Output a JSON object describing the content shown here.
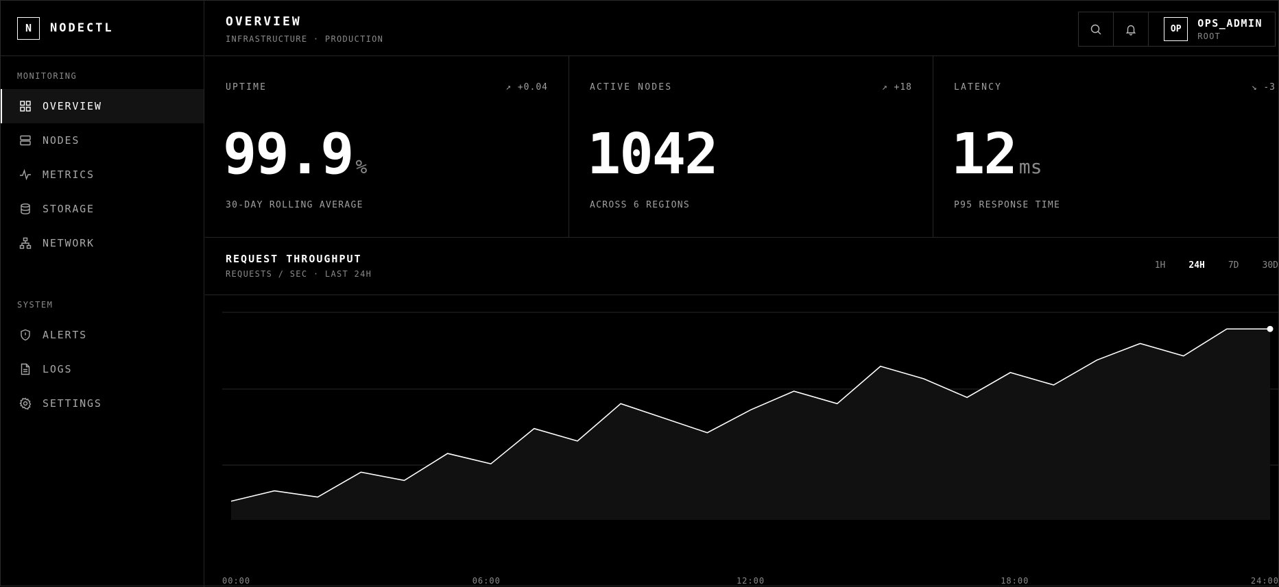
{
  "brand": {
    "logo": "N",
    "name": "NODECTL"
  },
  "sidebar": {
    "sections": [
      {
        "label": "MONITORING",
        "items": [
          {
            "label": "OVERVIEW",
            "icon": "grid-icon",
            "active": true
          },
          {
            "label": "NODES",
            "icon": "server-icon",
            "active": false
          },
          {
            "label": "METRICS",
            "icon": "activity-icon",
            "active": false
          },
          {
            "label": "STORAGE",
            "icon": "database-icon",
            "active": false
          },
          {
            "label": "NETWORK",
            "icon": "network-icon",
            "active": false
          }
        ]
      },
      {
        "label": "SYSTEM",
        "items": [
          {
            "label": "ALERTS",
            "icon": "shield-alert-icon",
            "active": false
          },
          {
            "label": "LOGS",
            "icon": "file-icon",
            "active": false
          },
          {
            "label": "SETTINGS",
            "icon": "gear-icon",
            "active": false
          }
        ]
      }
    ]
  },
  "header": {
    "title": "OVERVIEW",
    "subtitle": "INFRASTRUCTURE · PRODUCTION",
    "user": {
      "initials": "OP",
      "name": "OPS_ADMIN",
      "role": "ROOT"
    }
  },
  "stats": [
    {
      "label": "UPTIME",
      "delta_icon": "↗",
      "delta": "+0.04",
      "value": "99.9",
      "unit": "%",
      "caption": "30-DAY ROLLING AVERAGE"
    },
    {
      "label": "ACTIVE NODES",
      "delta_icon": "↗",
      "delta": "+18",
      "value": "1042",
      "unit": "",
      "caption": "ACROSS 6 REGIONS"
    },
    {
      "label": "LATENCY",
      "delta_icon": "↘",
      "delta": "-3",
      "value": "12",
      "unit": "ms",
      "caption": "P95 RESPONSE TIME"
    }
  ],
  "chart": {
    "title": "REQUEST THROUGHPUT",
    "subtitle": "REQUESTS / SEC · LAST 24H",
    "ranges": [
      {
        "label": "1H",
        "active": false
      },
      {
        "label": "24H",
        "active": true
      },
      {
        "label": "7D",
        "active": false
      },
      {
        "label": "30D",
        "active": false
      }
    ]
  },
  "chart_data": {
    "type": "area",
    "x_tick_labels": [
      "00:00",
      "06:00",
      "12:00",
      "18:00",
      "24:00"
    ],
    "x_range": [
      0,
      24
    ],
    "ylim": [
      0,
      100
    ],
    "grid": true,
    "series": [
      {
        "x": [
          0,
          1,
          2,
          3,
          4,
          5,
          6,
          7,
          8,
          9,
          10,
          11,
          12,
          13,
          14,
          15,
          16,
          17,
          18,
          19,
          20,
          21,
          22,
          23,
          24
        ],
        "values": [
          9,
          14,
          11,
          23,
          19,
          32,
          27,
          44,
          38,
          56,
          49,
          42,
          53,
          62,
          56,
          74,
          68,
          59,
          71,
          65,
          77,
          85,
          79,
          92,
          92
        ]
      }
    ],
    "colors": {
      "line": "#ffffff",
      "fill": "#111111",
      "grid": "#2a2a2a"
    }
  }
}
